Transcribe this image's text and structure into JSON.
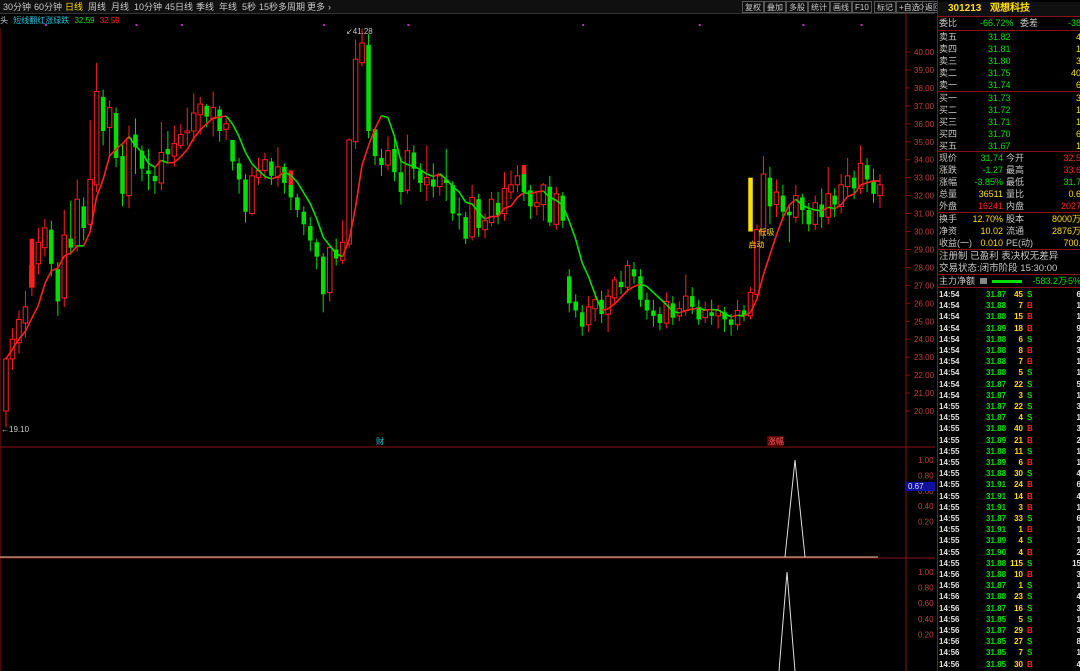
{
  "toolbar": {
    "periods": [
      "30分钟",
      "60分钟",
      "日线",
      "周线",
      "月线",
      "10分钟",
      "45日线",
      "季线",
      "年线",
      "5秒",
      "15秒",
      "多周期",
      "更多"
    ],
    "active": "日线",
    "tools": [
      "复权",
      "叠加",
      "多股",
      "统计",
      "画线",
      "F10",
      "标记",
      "+自选",
      "返回"
    ]
  },
  "legend": {
    "prefix": "头",
    "indicator": "短线翻红涨绿跌",
    "v1": "32.59",
    "v2": "32.59"
  },
  "colors": {
    "up": "#ff2020",
    "down": "#00e000",
    "bg": "#000000",
    "grid": "#8b1010",
    "yellow": "#ffdd00",
    "cyan": "#20c0e0"
  },
  "chart_data": {
    "type": "candlestick",
    "ylim": [
      19.1,
      42.0
    ],
    "yticks": [
      "40.00",
      "39.00",
      "38.00",
      "37.00",
      "36.00",
      "35.00",
      "34.00",
      "33.00",
      "32.00",
      "31.00",
      "30.00",
      "29.00",
      "28.00",
      "27.00",
      "26.00",
      "25.00",
      "24.00",
      "23.00",
      "22.00",
      "21.00",
      "20.00"
    ],
    "high_label": "41.28",
    "low_label": "19.10",
    "annotations": {
      "signal1": "低吸",
      "signal2": "启动",
      "marker1": "财",
      "marker2": "涨幅"
    },
    "candles": [
      [
        20.0,
        22.9,
        19.1,
        23.0
      ],
      [
        22.9,
        24.0,
        22.3,
        24.6
      ],
      [
        23.8,
        25.1,
        23.2,
        25.6
      ],
      [
        24.9,
        25.8,
        24.1,
        26.7
      ],
      [
        26.9,
        28.1,
        26.4,
        28.6
      ],
      [
        28.2,
        29.4,
        27.6,
        30.2
      ],
      [
        29.1,
        30.2,
        28.6,
        30.7
      ],
      [
        30.1,
        28.2,
        27.5,
        30.6
      ],
      [
        27.9,
        26.1,
        25.3,
        28.3
      ],
      [
        26.3,
        29.8,
        25.8,
        31.2
      ],
      [
        29.6,
        29.1,
        28.7,
        31.7
      ],
      [
        29.2,
        31.8,
        28.9,
        32.9
      ],
      [
        31.4,
        30.2,
        29.5,
        31.9
      ],
      [
        30.4,
        32.9,
        30.1,
        36.2
      ],
      [
        32.6,
        37.8,
        32.2,
        39.4
      ],
      [
        37.5,
        35.6,
        34.8,
        37.9
      ],
      [
        35.8,
        36.9,
        34.2,
        37.3
      ],
      [
        36.6,
        34.1,
        33.6,
        36.9
      ],
      [
        34.2,
        32.1,
        31.4,
        34.9
      ],
      [
        32.0,
        35.2,
        31.3,
        35.9
      ],
      [
        35.4,
        34.7,
        33.2,
        36.3
      ],
      [
        34.5,
        33.5,
        32.8,
        34.8
      ],
      [
        33.4,
        33.2,
        32.3,
        34.6
      ],
      [
        33.1,
        32.8,
        32.1,
        33.6
      ],
      [
        32.7,
        34.4,
        32.3,
        36.1
      ],
      [
        34.6,
        34.3,
        33.8,
        35.6
      ],
      [
        34.2,
        34.9,
        33.6,
        35.9
      ],
      [
        34.8,
        35.4,
        34.6,
        36.0
      ],
      [
        35.5,
        35.6,
        34.8,
        36.9
      ],
      [
        35.6,
        36.6,
        35.0,
        37.7
      ],
      [
        36.5,
        37.1,
        35.4,
        37.5
      ],
      [
        37.0,
        36.4,
        35.8,
        37.1
      ],
      [
        36.3,
        36.9,
        35.3,
        37.8
      ],
      [
        36.8,
        35.6,
        35.0,
        37.0
      ],
      [
        35.7,
        36.0,
        35.1,
        36.3
      ],
      [
        35.1,
        33.9,
        33.4,
        35.1
      ],
      [
        33.8,
        32.9,
        32.1,
        34.1
      ],
      [
        32.9,
        31.1,
        30.5,
        33.2
      ],
      [
        31.0,
        33.1,
        30.9,
        33.6
      ],
      [
        33.0,
        33.4,
        32.6,
        34.1
      ],
      [
        33.4,
        34.0,
        32.9,
        34.4
      ],
      [
        33.9,
        33.1,
        32.6,
        34.1
      ],
      [
        33.0,
        33.6,
        32.5,
        34.7
      ],
      [
        33.6,
        32.7,
        32.1,
        33.8
      ],
      [
        32.6,
        31.9,
        31.2,
        32.6
      ],
      [
        31.9,
        31.2,
        30.8,
        32.1
      ],
      [
        31.1,
        30.4,
        29.8,
        31.4
      ],
      [
        30.3,
        29.5,
        28.9,
        30.8
      ],
      [
        29.4,
        28.6,
        27.9,
        29.6
      ],
      [
        28.6,
        26.5,
        25.5,
        28.8
      ],
      [
        26.6,
        29.1,
        26.1,
        29.3
      ],
      [
        29.0,
        28.5,
        28.1,
        29.6
      ],
      [
        28.4,
        29.4,
        28.2,
        30.6
      ],
      [
        29.3,
        35.1,
        29.1,
        35.2
      ],
      [
        35.0,
        39.6,
        34.6,
        40.7
      ],
      [
        39.4,
        40.5,
        39.2,
        41.3
      ],
      [
        40.4,
        35.6,
        35.2,
        41.0
      ],
      [
        35.7,
        34.2,
        33.7,
        35.8
      ],
      [
        34.1,
        33.7,
        33.1,
        34.6
      ],
      [
        33.7,
        34.5,
        33.4,
        35.3
      ],
      [
        34.6,
        33.3,
        32.8,
        35.2
      ],
      [
        33.3,
        32.2,
        31.5,
        34.1
      ],
      [
        32.3,
        34.5,
        32.1,
        35.4
      ],
      [
        34.4,
        33.5,
        32.9,
        34.8
      ],
      [
        33.4,
        32.7,
        32.2,
        33.8
      ],
      [
        32.6,
        33.0,
        31.7,
        34.8
      ],
      [
        32.9,
        32.5,
        31.9,
        33.8
      ],
      [
        32.5,
        33.1,
        32.0,
        33.2
      ],
      [
        32.9,
        32.7,
        31.7,
        34.6
      ],
      [
        32.6,
        31.0,
        30.6,
        32.8
      ],
      [
        31.0,
        30.9,
        30.1,
        31.9
      ],
      [
        30.8,
        29.6,
        29.3,
        31.1
      ],
      [
        29.7,
        31.9,
        29.5,
        32.6
      ],
      [
        31.8,
        30.2,
        29.7,
        32.1
      ],
      [
        30.1,
        30.6,
        29.6,
        31.0
      ],
      [
        30.5,
        31.8,
        30.3,
        32.2
      ],
      [
        31.6,
        30.9,
        30.4,
        32.2
      ],
      [
        31.0,
        32.4,
        30.6,
        33.3
      ],
      [
        32.2,
        32.6,
        31.8,
        33.4
      ],
      [
        32.6,
        33.1,
        32.2,
        33.7
      ],
      [
        33.2,
        32.2,
        31.7,
        33.4
      ],
      [
        32.3,
        31.4,
        30.7,
        32.6
      ],
      [
        31.4,
        31.6,
        30.9,
        32.2
      ],
      [
        31.5,
        32.6,
        30.6,
        32.7
      ],
      [
        32.5,
        30.5,
        30.3,
        33.1
      ],
      [
        30.4,
        32.1,
        30.1,
        32.5
      ],
      [
        32.0,
        30.6,
        30.2,
        32.2
      ],
      [
        27.5,
        26.0,
        25.5,
        27.9
      ],
      [
        26.1,
        25.6,
        25.2,
        26.5
      ],
      [
        25.5,
        24.7,
        24.2,
        25.9
      ],
      [
        24.8,
        25.8,
        24.4,
        26.4
      ],
      [
        25.7,
        26.2,
        25.0,
        26.6
      ],
      [
        26.2,
        25.4,
        24.9,
        26.7
      ],
      [
        25.4,
        26.4,
        24.4,
        26.8
      ],
      [
        26.3,
        27.3,
        25.9,
        27.5
      ],
      [
        27.2,
        26.9,
        26.5,
        27.8
      ],
      [
        26.9,
        28.1,
        26.6,
        28.4
      ],
      [
        27.9,
        27.5,
        27.1,
        28.3
      ],
      [
        27.5,
        26.2,
        25.8,
        27.9
      ],
      [
        26.2,
        25.6,
        25.1,
        26.6
      ],
      [
        25.6,
        25.3,
        24.7,
        26.2
      ],
      [
        25.4,
        24.9,
        24.5,
        25.8
      ],
      [
        24.9,
        26.1,
        24.6,
        26.6
      ],
      [
        26.0,
        25.2,
        24.8,
        26.4
      ],
      [
        25.3,
        25.7,
        25.0,
        26.1
      ],
      [
        25.6,
        26.4,
        25.3,
        27.6
      ],
      [
        26.4,
        25.8,
        25.4,
        26.9
      ],
      [
        25.8,
        25.1,
        24.8,
        26.2
      ],
      [
        25.2,
        25.6,
        24.9,
        26.1
      ],
      [
        25.5,
        25.3,
        24.8,
        26.2
      ],
      [
        25.3,
        25.6,
        24.6,
        25.9
      ],
      [
        25.5,
        25.1,
        24.4,
        25.8
      ],
      [
        25.1,
        24.8,
        24.2,
        25.4
      ],
      [
        24.8,
        25.6,
        24.5,
        26.2
      ],
      [
        25.6,
        25.3,
        25.0,
        25.9
      ],
      [
        25.3,
        26.6,
        25.1,
        26.9
      ],
      [
        26.5,
        30.1,
        26.2,
        30.4
      ],
      [
        30.0,
        33.2,
        29.6,
        34.2
      ],
      [
        33.0,
        31.4,
        30.4,
        33.6
      ],
      [
        31.5,
        32.2,
        30.8,
        32.9
      ],
      [
        32.0,
        31.1,
        30.6,
        32.6
      ],
      [
        31.1,
        30.9,
        29.4,
        31.5
      ],
      [
        30.8,
        32.0,
        30.5,
        32.6
      ],
      [
        31.9,
        31.2,
        30.4,
        32.1
      ],
      [
        31.2,
        30.4,
        30.0,
        31.6
      ],
      [
        30.4,
        31.6,
        30.1,
        32.0
      ],
      [
        31.5,
        30.8,
        30.2,
        32.4
      ],
      [
        30.8,
        32.1,
        30.4,
        33.6
      ],
      [
        32.0,
        31.5,
        30.8,
        32.4
      ],
      [
        31.4,
        32.6,
        31.0,
        33.2
      ],
      [
        32.5,
        33.1,
        32.0,
        34.1
      ],
      [
        33.0,
        32.4,
        31.8,
        33.4
      ],
      [
        32.4,
        33.8,
        32.1,
        34.8
      ],
      [
        33.7,
        32.9,
        32.2,
        34.1
      ],
      [
        32.8,
        32.1,
        31.6,
        33.5
      ],
      [
        32.0,
        32.6,
        31.3,
        33.2
      ]
    ]
  },
  "sub1": {
    "ticks": [
      "1.00",
      "0.80",
      "0.60",
      "0.40",
      "0.20"
    ],
    "marker": "0.67"
  },
  "sub2": {
    "ticks": [
      "1.00",
      "0.80",
      "0.60",
      "0.40",
      "0.20"
    ]
  },
  "quote": {
    "code": "301213",
    "name": "观想科技",
    "weibi_label": "委比",
    "weibi": "-66.72%",
    "weicha_label": "委差",
    "weicha": "-38",
    "asks": [
      {
        "label": "卖五",
        "price": "31.82",
        "vol": "4"
      },
      {
        "label": "卖四",
        "price": "31.81",
        "vol": "1"
      },
      {
        "label": "卖三",
        "price": "31.80",
        "vol": "3"
      },
      {
        "label": "卖二",
        "price": "31.75",
        "vol": "40"
      },
      {
        "label": "卖一",
        "price": "31.74",
        "vol": "6"
      }
    ],
    "bids": [
      {
        "label": "买一",
        "price": "31.73",
        "vol": "3"
      },
      {
        "label": "买二",
        "price": "31.72",
        "vol": "1"
      },
      {
        "label": "买三",
        "price": "31.71",
        "vol": "1"
      },
      {
        "label": "买四",
        "price": "31.70",
        "vol": "6"
      },
      {
        "label": "买五",
        "price": "31.67",
        "vol": "1"
      }
    ],
    "stats": [
      {
        "l1": "现价",
        "v1": "31.74",
        "l2": "今开",
        "v2": "32.5"
      },
      {
        "l1": "涨跌",
        "v1": "-1.27",
        "l2": "最高",
        "v2": "33.6"
      },
      {
        "l1": "涨幅",
        "v1": "-3.85%",
        "l2": "最低",
        "v2": "31.7"
      },
      {
        "l1": "总量",
        "v1": "36511",
        "l2": "量比",
        "v2": "0.6"
      },
      {
        "l1": "外盘",
        "v1": "16241",
        "l2": "内盘",
        "v2": "2027"
      }
    ],
    "stats2": [
      {
        "l1": "换手",
        "v1": "12.70%",
        "l2": "股本",
        "v2": "8000万"
      },
      {
        "l1": "净资",
        "v1": "10.02",
        "l2": "流通",
        "v2": "2876万"
      },
      {
        "l1": "收益(一)",
        "v1": "0.010",
        "l2": "PE(动)",
        "v2": "700."
      }
    ],
    "info1": "注册制 已盈利 表决权无差异",
    "info2": "交易状态:闭市阶段 15:30:00",
    "flow_label": "主力净额",
    "flow_value": "-583.2万",
    "flow_pct": "-5%"
  },
  "ticks": [
    [
      "14:54",
      "31.87",
      "45",
      "S",
      "6"
    ],
    [
      "14:54",
      "31.88",
      "7",
      "B",
      "1"
    ],
    [
      "14:54",
      "31.88",
      "15",
      "B",
      "1"
    ],
    [
      "14:54",
      "31.89",
      "18",
      "B",
      "9"
    ],
    [
      "14:54",
      "31.88",
      "6",
      "S",
      "2"
    ],
    [
      "14:54",
      "31.88",
      "8",
      "B",
      "3"
    ],
    [
      "14:54",
      "31.88",
      "7",
      "B",
      "1"
    ],
    [
      "14:54",
      "31.88",
      "5",
      "S",
      "1"
    ],
    [
      "14:54",
      "31.87",
      "22",
      "S",
      "5"
    ],
    [
      "14:54",
      "31.87",
      "3",
      "S",
      "1"
    ],
    [
      "14:55",
      "31.87",
      "22",
      "S",
      "3"
    ],
    [
      "14:55",
      "31.87",
      "4",
      "S",
      "1"
    ],
    [
      "14:55",
      "31.88",
      "40",
      "B",
      "3"
    ],
    [
      "14:55",
      "31.89",
      "21",
      "B",
      "2"
    ],
    [
      "14:55",
      "31.88",
      "11",
      "S",
      "1"
    ],
    [
      "14:55",
      "31.89",
      "6",
      "B",
      "1"
    ],
    [
      "14:55",
      "31.88",
      "30",
      "S",
      "4"
    ],
    [
      "14:55",
      "31.91",
      "24",
      "B",
      "6"
    ],
    [
      "14:55",
      "31.91",
      "14",
      "B",
      "4"
    ],
    [
      "14:55",
      "31.91",
      "3",
      "B",
      "1"
    ],
    [
      "14:55",
      "31.87",
      "33",
      "S",
      "6"
    ],
    [
      "14:55",
      "31.91",
      "1",
      "B",
      "1"
    ],
    [
      "14:55",
      "31.89",
      "4",
      "S",
      "1"
    ],
    [
      "14:55",
      "31.90",
      "4",
      "B",
      "2"
    ],
    [
      "14:55",
      "31.88",
      "115",
      "S",
      "15"
    ],
    [
      "14:56",
      "31.88",
      "10",
      "B",
      "3"
    ],
    [
      "14:56",
      "31.87",
      "1",
      "S",
      "1"
    ],
    [
      "14:56",
      "31.88",
      "23",
      "S",
      "4"
    ],
    [
      "14:56",
      "31.87",
      "16",
      "S",
      "3"
    ],
    [
      "14:56",
      "31.85",
      "5",
      "S",
      "1"
    ],
    [
      "14:56",
      "31.87",
      "29",
      "B",
      "3"
    ],
    [
      "14:56",
      "31.85",
      "27",
      "S",
      "8"
    ],
    [
      "14:56",
      "31.85",
      "7",
      "S",
      "1"
    ],
    [
      "14:56",
      "31.85",
      "30",
      "B",
      "4"
    ]
  ]
}
